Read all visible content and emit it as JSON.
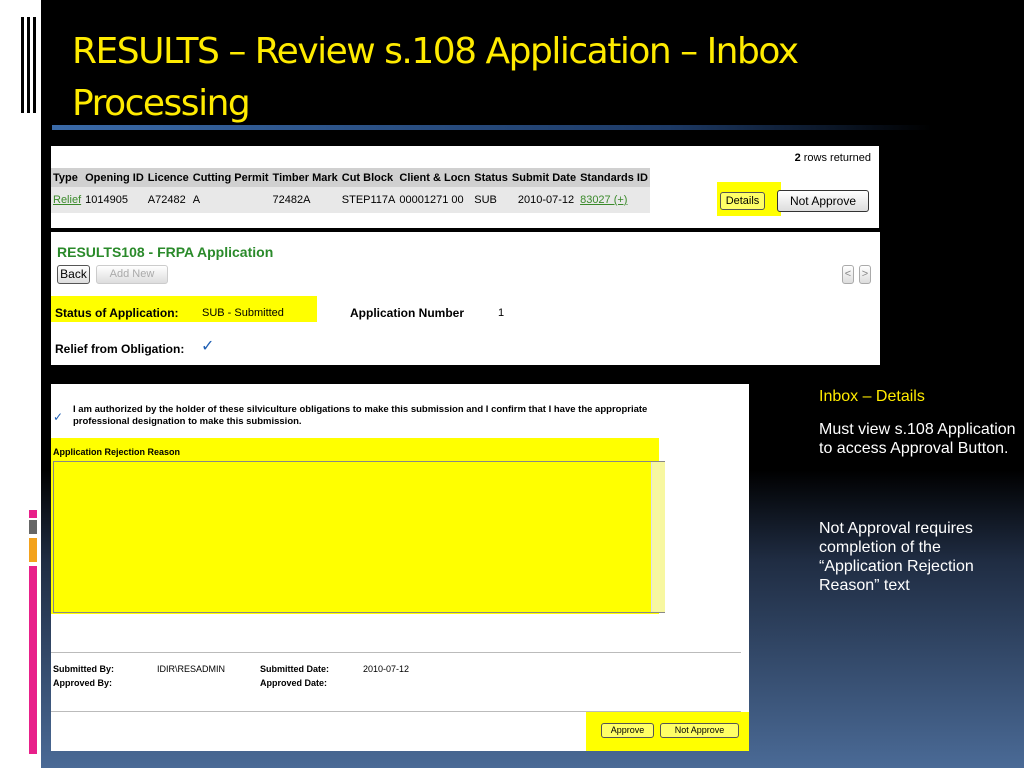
{
  "slide": {
    "title": "RESULTS – Review s.108 Application – Inbox Processing",
    "accent_color": "#ffeb00",
    "highlight_color": "#ffff00",
    "link_color": "#3a8a2a"
  },
  "results_table": {
    "rows_count": "2",
    "rows_label": " rows returned",
    "columns": [
      "Type",
      "Opening ID",
      "Licence",
      "Cutting Permit",
      "Timber Mark",
      "Cut Block",
      "Client & Locn",
      "Status",
      "Submit Date",
      "Standards ID"
    ],
    "row": {
      "type": "Relief",
      "opening_id": "1014905",
      "licence": "A72482",
      "cutting_permit": "A",
      "timber_mark": "72482A",
      "cut_block": "STEP117A",
      "client_locn": "00001271 00",
      "status": "SUB",
      "submit_date": "2010-07-12",
      "standards_id": "83027 (+)"
    },
    "details_label": "Details",
    "not_approve_label": "Not Approve"
  },
  "application_header": {
    "title": "RESULTS108 - FRPA Application",
    "back_label": "Back",
    "add_new_label": "Add New",
    "prev_label": "<",
    "next_label": ">",
    "status_label": "Status of Application:",
    "status_value": "SUB  -  Submitted",
    "app_number_label": "Application Number",
    "app_number_value": "1",
    "relief_label": "Relief from Obligation:",
    "relief_check": "✓"
  },
  "application_form": {
    "confirm_check": "✓",
    "confirm_text": "I am authorized by the holder of these silviculture obligations to make this submission and I confirm that I have the appropriate professional designation to make this submission.",
    "rejection_label": "Application Rejection Reason",
    "rejection_value": "",
    "submitted_by_label": "Submitted By:",
    "submitted_by_value": "IDIR\\RESADMIN",
    "submitted_date_label": "Submitted Date:",
    "submitted_date_value": "2010-07-12",
    "approved_by_label": "Approved By:",
    "approved_date_label": "Approved Date:",
    "approve_label": "Approve",
    "not_approve_label": "Not Approve"
  },
  "notes": {
    "heading": "Inbox – Details",
    "p1": "Must view s.108 Application to access Approval Button.",
    "p2": "Not Approval requires completion of the “Application Rejection Reason” text"
  }
}
